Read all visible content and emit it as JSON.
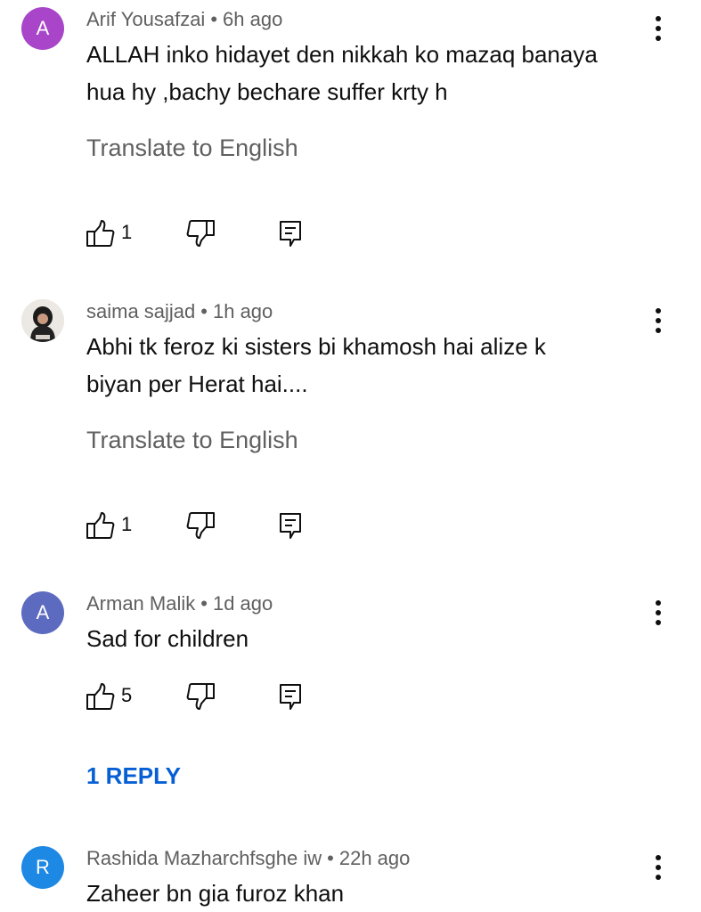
{
  "comments": [
    {
      "author": "Arif Yousafzai",
      "time": "6h ago",
      "avatar_letter": "A",
      "avatar_color": "#a845c8",
      "text_lines": [
        "ALLAH inko hidayet den nikkah ko mazaq banaya",
        "hua hy ,bachy bechare suffer krty h"
      ],
      "translate_label": "Translate to English",
      "likes": "1"
    },
    {
      "author": "saima sajjad",
      "time": "1h ago",
      "avatar_letter": "",
      "avatar_color": "#e9e6e2",
      "text_lines": [
        "Abhi tk feroz ki sisters bi khamosh hai alize k",
        "biyan per Herat hai...."
      ],
      "translate_label": "Translate to English",
      "likes": "1"
    },
    {
      "author": "Arman Malik",
      "time": "1d ago",
      "avatar_letter": "A",
      "avatar_color": "#5c6bc0",
      "text_lines": [
        "Sad for children"
      ],
      "likes": "5",
      "reply_label": "1 REPLY"
    },
    {
      "author": "Rashida Mazharchfsghe iw",
      "time": "22h ago",
      "avatar_letter": "R",
      "avatar_color": "#1e88e5",
      "text_lines": [
        "Zaheer bn gia furoz khan"
      ]
    }
  ],
  "separator": "•",
  "icons": {
    "like": "thumbs-up-icon",
    "dislike": "thumbs-down-icon",
    "reply": "reply-comment-icon",
    "more": "more-vertical-icon"
  }
}
